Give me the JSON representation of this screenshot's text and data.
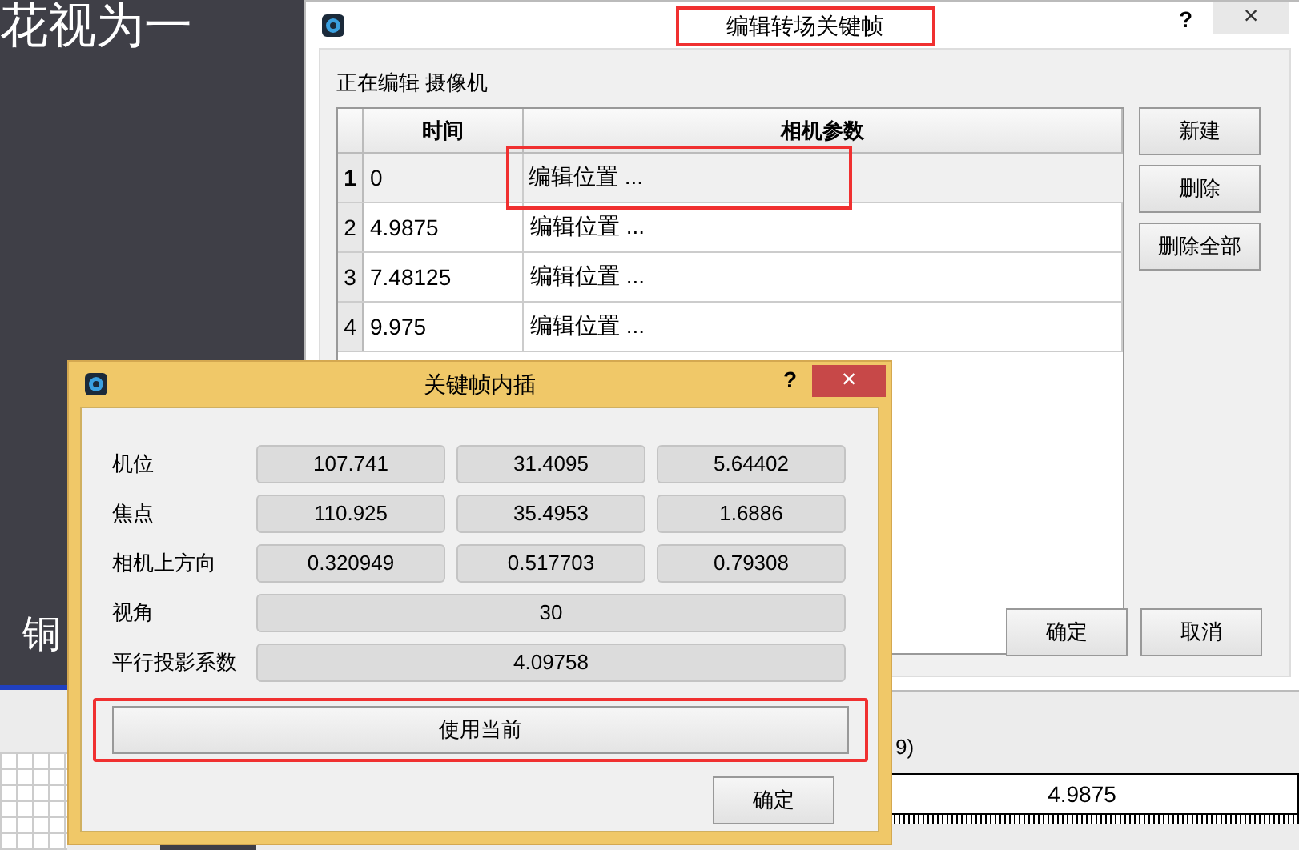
{
  "background": {
    "heading_fragment": "花视为一",
    "side_char": "铜"
  },
  "main_dialog": {
    "title": "编辑转场关键帧",
    "title_highlighted": true,
    "help": "?",
    "close": "×",
    "editing_label": "正在编辑 摄像机",
    "table": {
      "columns": [
        "时间",
        "相机参数"
      ],
      "rows": [
        {
          "index": "1",
          "time": "0",
          "params": "编辑位置 ...",
          "selected": true,
          "highlighted": true
        },
        {
          "index": "2",
          "time": "4.9875",
          "params": "编辑位置 ...",
          "selected": false,
          "highlighted": false
        },
        {
          "index": "3",
          "time": "7.48125",
          "params": "编辑位置 ...",
          "selected": false,
          "highlighted": false
        },
        {
          "index": "4",
          "time": "9.975",
          "params": "编辑位置 ...",
          "selected": false,
          "highlighted": false
        }
      ]
    },
    "side_buttons": [
      "新建",
      "删除",
      "删除全部"
    ],
    "ok": "确定",
    "cancel": "取消"
  },
  "interp_dialog": {
    "title": "关键帧内插",
    "help": "?",
    "close": "×",
    "rows": [
      {
        "label": "机位",
        "values": [
          "107.741",
          "31.4095",
          "5.64402"
        ]
      },
      {
        "label": "焦点",
        "values": [
          "110.925",
          "35.4953",
          "1.6886"
        ]
      },
      {
        "label": "相机上方向",
        "values": [
          "0.320949",
          "0.517703",
          "0.79308"
        ]
      },
      {
        "label": "视角",
        "values": [
          "30"
        ]
      },
      {
        "label": "平行投影系数",
        "values": [
          "4.09758"
        ]
      }
    ],
    "use_current": "使用当前",
    "use_current_highlighted": true,
    "ok": "确定"
  },
  "timeline": {
    "partial_label": "9)",
    "value": "4.9875"
  }
}
